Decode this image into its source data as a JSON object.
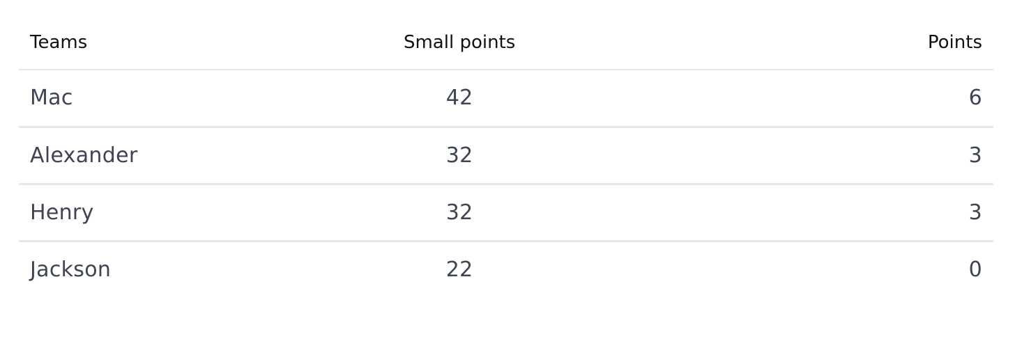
{
  "table": {
    "headers": {
      "team": "Teams",
      "small_points": "Small points",
      "points": "Points"
    },
    "rows": [
      {
        "team": "Mac",
        "small_points": "42",
        "points": "6"
      },
      {
        "team": "Alexander",
        "small_points": "32",
        "points": "3"
      },
      {
        "team": "Henry",
        "small_points": "32",
        "points": "3"
      },
      {
        "team": "Jackson",
        "small_points": "22",
        "points": "0"
      }
    ]
  }
}
